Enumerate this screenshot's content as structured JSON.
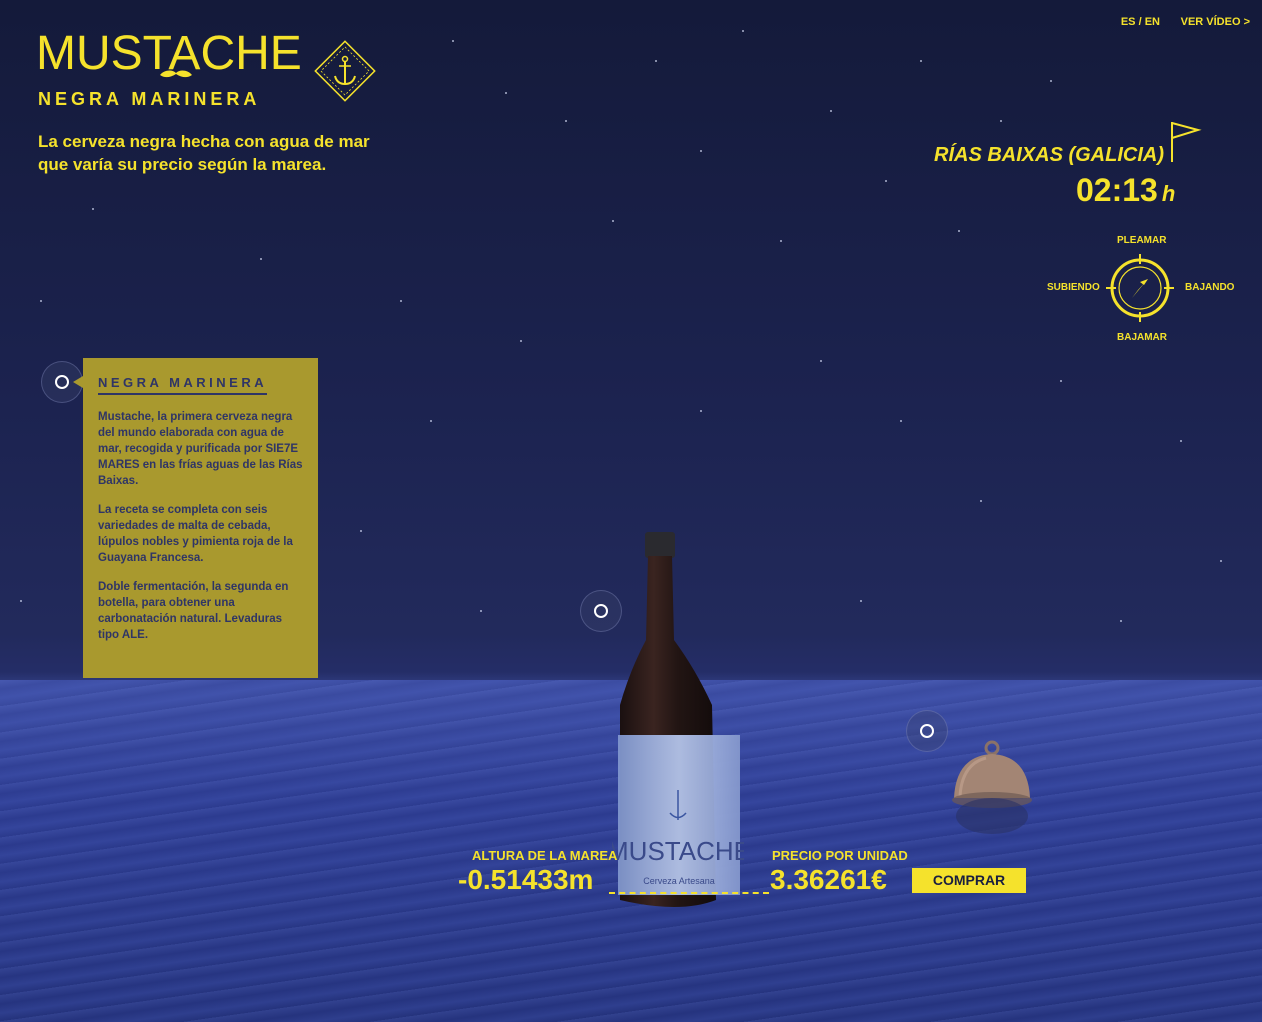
{
  "brand": {
    "title": "MUSTACHE",
    "subtitle": "NEGRA MARINERA",
    "tagline": "La cerveza negra hecha con agua de mar que varía su precio según la marea."
  },
  "nav": {
    "lang_es": "ES",
    "lang_sep": "/",
    "lang_en": "EN",
    "video_link": "VER VÍDEO >"
  },
  "location": {
    "name": "RÍAS BAIXAS (GALICIA)",
    "time": "02:13",
    "time_unit": "h"
  },
  "tide_compass": {
    "top": "PLEAMAR",
    "left": "SUBIENDO",
    "right": "BAJANDO",
    "bottom": "BAJAMAR"
  },
  "info": {
    "title": "NEGRA MARINERA",
    "paragraphs": [
      "Mustache, la primera cerveza negra del mundo elaborada con agua de mar, recogida y purificada por SIE7E MARES en las frías aguas de las Rías Baixas.",
      "La receta se completa con seis variedades de malta de cebada, lúpulos nobles y pimienta roja de la Guayana Francesa.",
      "Doble fermentación, la segunda en botella, para obtener una carbonatación natural. Levaduras tipo ALE."
    ]
  },
  "product": {
    "bottle_label": "MUSTACHE",
    "bottle_sublabel": "Cerveza Artesana"
  },
  "stats": {
    "tide_label": "ALTURA DE LA MAREA",
    "tide_value": "-0.51433m",
    "price_label": "PRECIO POR UNIDAD",
    "price_value": "3.36261€",
    "buy_button": "COMPRAR"
  },
  "colors": {
    "accent": "#f5e22c",
    "info_bg": "#a9992e",
    "info_text": "#2f3566"
  }
}
